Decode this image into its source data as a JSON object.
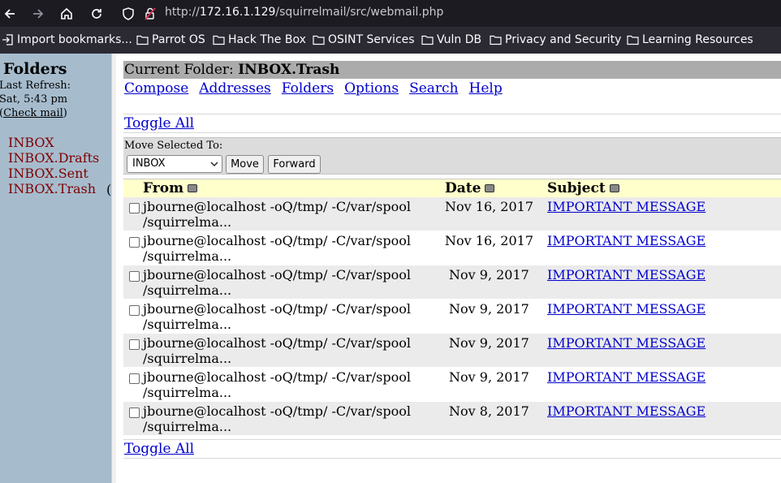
{
  "browser": {
    "url_prefix": "http://",
    "url_host": "172.16.1.129",
    "url_path": "/squirrelmail/src/webmail.php",
    "bookmarks": [
      "Import bookmarks...",
      "Parrot OS",
      "Hack The Box",
      "OSINT Services",
      "Vuln DB",
      "Privacy and Security",
      "Learning Resources"
    ]
  },
  "sidebar": {
    "title": "Folders",
    "last_refresh_label": "Last Refresh:",
    "last_refresh_time": "Sat, 5:43 pm",
    "check_mail_open": "(",
    "check_mail_link": "Check mail",
    "check_mail_close": ")",
    "folders": [
      "INBOX",
      "INBOX.Drafts",
      "INBOX.Sent",
      "INBOX.Trash"
    ],
    "trash_suffix": "("
  },
  "main": {
    "current_folder_label": "Current Folder: ",
    "current_folder": "INBOX.Trash",
    "menu": [
      "Compose",
      "Addresses",
      "Folders",
      "Options",
      "Search",
      "Help"
    ],
    "toggle_all": "Toggle All",
    "move_selected_label": "Move Selected To:",
    "move_target": "INBOX",
    "move_button": "Move",
    "forward_button": "Forward",
    "columns": {
      "from": "From",
      "date": "Date",
      "subject": "Subject"
    },
    "messages": [
      {
        "from_line1": "jbourne@localhost -oQ/tmp/ -C/var/spool",
        "from_line2": "/squirrelma...",
        "date": "Nov 16, 2017",
        "subject": "IMPORTANT MESSAGE"
      },
      {
        "from_line1": "jbourne@localhost -oQ/tmp/ -C/var/spool",
        "from_line2": "/squirrelma...",
        "date": "Nov 16, 2017",
        "subject": "IMPORTANT MESSAGE"
      },
      {
        "from_line1": "jbourne@localhost -oQ/tmp/ -C/var/spool",
        "from_line2": "/squirrelma...",
        "date": "Nov 9, 2017",
        "subject": "IMPORTANT MESSAGE"
      },
      {
        "from_line1": "jbourne@localhost -oQ/tmp/ -C/var/spool",
        "from_line2": "/squirrelma...",
        "date": "Nov 9, 2017",
        "subject": "IMPORTANT MESSAGE"
      },
      {
        "from_line1": "jbourne@localhost -oQ/tmp/ -C/var/spool",
        "from_line2": "/squirrelma...",
        "date": "Nov 9, 2017",
        "subject": "IMPORTANT MESSAGE"
      },
      {
        "from_line1": "jbourne@localhost -oQ/tmp/ -C/var/spool",
        "from_line2": "/squirrelma...",
        "date": "Nov 9, 2017",
        "subject": "IMPORTANT MESSAGE"
      },
      {
        "from_line1": "jbourne@localhost -oQ/tmp/ -C/var/spool",
        "from_line2": "/squirrelma...",
        "date": "Nov 8, 2017",
        "subject": "IMPORTANT MESSAGE"
      }
    ]
  },
  "colors": {
    "sidebar_bg": "#a6bccd",
    "folder_text": "#800000",
    "link": "#0000cc",
    "header_row_bg": "#ffffcc",
    "current_folder_bg": "#ababab"
  }
}
